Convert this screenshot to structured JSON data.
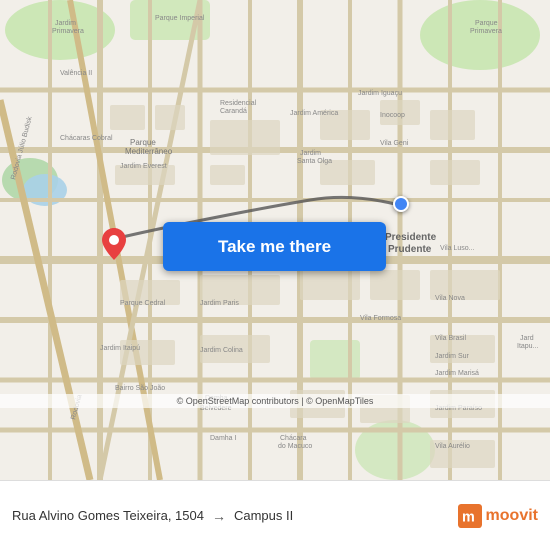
{
  "map": {
    "button_label": "Take me there",
    "attribution": "© OpenStreetMap contributors | © OpenMapTiles",
    "background_color": "#e8e0d8"
  },
  "bottom_bar": {
    "origin": "Rua Alvino Gomes Teixeira, 1504",
    "destination": "Campus II",
    "arrow": "→",
    "brand": "moovit"
  },
  "markers": {
    "pin_color": "#e84040",
    "dot_color": "#4285F4"
  }
}
